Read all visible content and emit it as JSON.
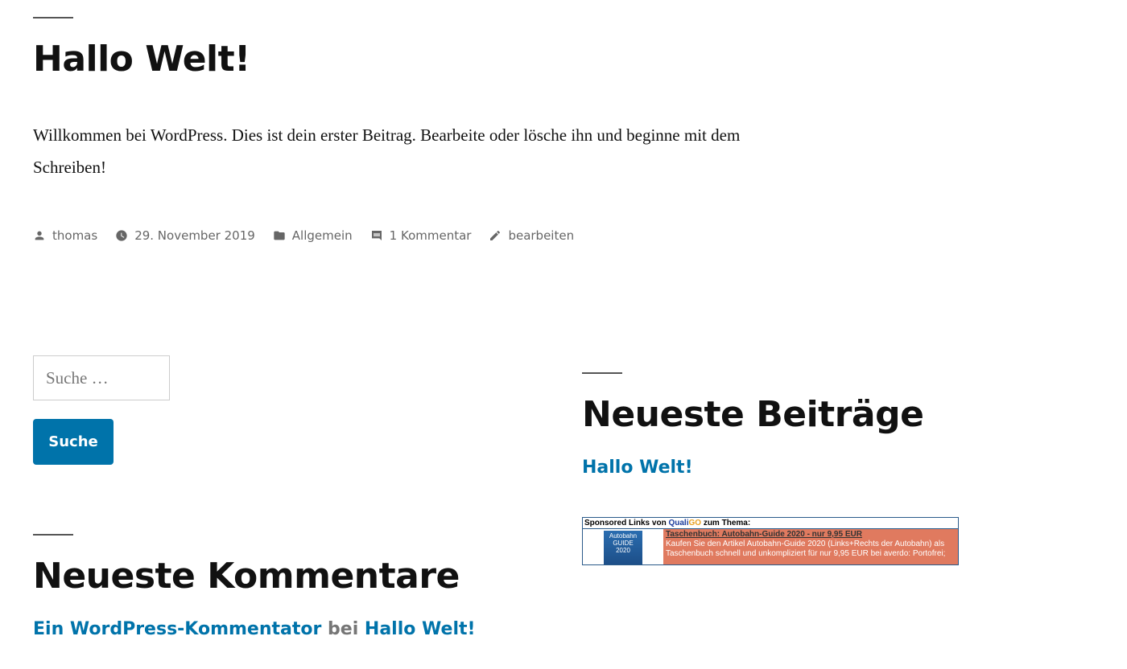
{
  "post": {
    "title": "Hallo Welt!",
    "body": "Willkommen bei WordPress. Dies ist dein erster Beitrag. Bearbeite oder lösche ihn und beginne mit dem Schreiben!",
    "meta": {
      "author": "thomas",
      "date": "29. November 2019",
      "category": "Allgemein",
      "comments": "1 Kommentar",
      "edit": "bearbeiten"
    }
  },
  "search": {
    "placeholder": "Suche …",
    "button_label": "Suche"
  },
  "recent_posts": {
    "title": "Neueste Beiträge",
    "items": [
      "Hallo Welt!"
    ]
  },
  "recent_comments": {
    "title": "Neueste Kommentare",
    "author": "Ein WordPress-Kommentator",
    "connector": "bei",
    "post": "Hallo Welt!"
  },
  "ad": {
    "header_prefix": "Sponsored Links von ",
    "brand_part1": "Quali",
    "brand_part2": "GO",
    "header_suffix": " zum Thema:",
    "book_label_1": "Autobahn",
    "book_label_2": "GUIDE",
    "book_label_3": "2020",
    "item_title": "Taschenbuch: Autobahn-Guide 2020 - nur 9,95 EUR",
    "item_text": "Kaufen Sie den Artikel Autobahn-Guide 2020 (Links+Rechts der Autobahn) als Taschenbuch schnell und unkompliziert für nur 9,95 EUR bei averdo: Portofrei;"
  },
  "colors": {
    "link": "#0073aa",
    "button": "#0073aa",
    "meta_text": "#666666",
    "ad_text_bg": "#e07a5f"
  },
  "icons": [
    "person-icon",
    "clock-icon",
    "folder-icon",
    "comment-icon",
    "pencil-icon"
  ]
}
